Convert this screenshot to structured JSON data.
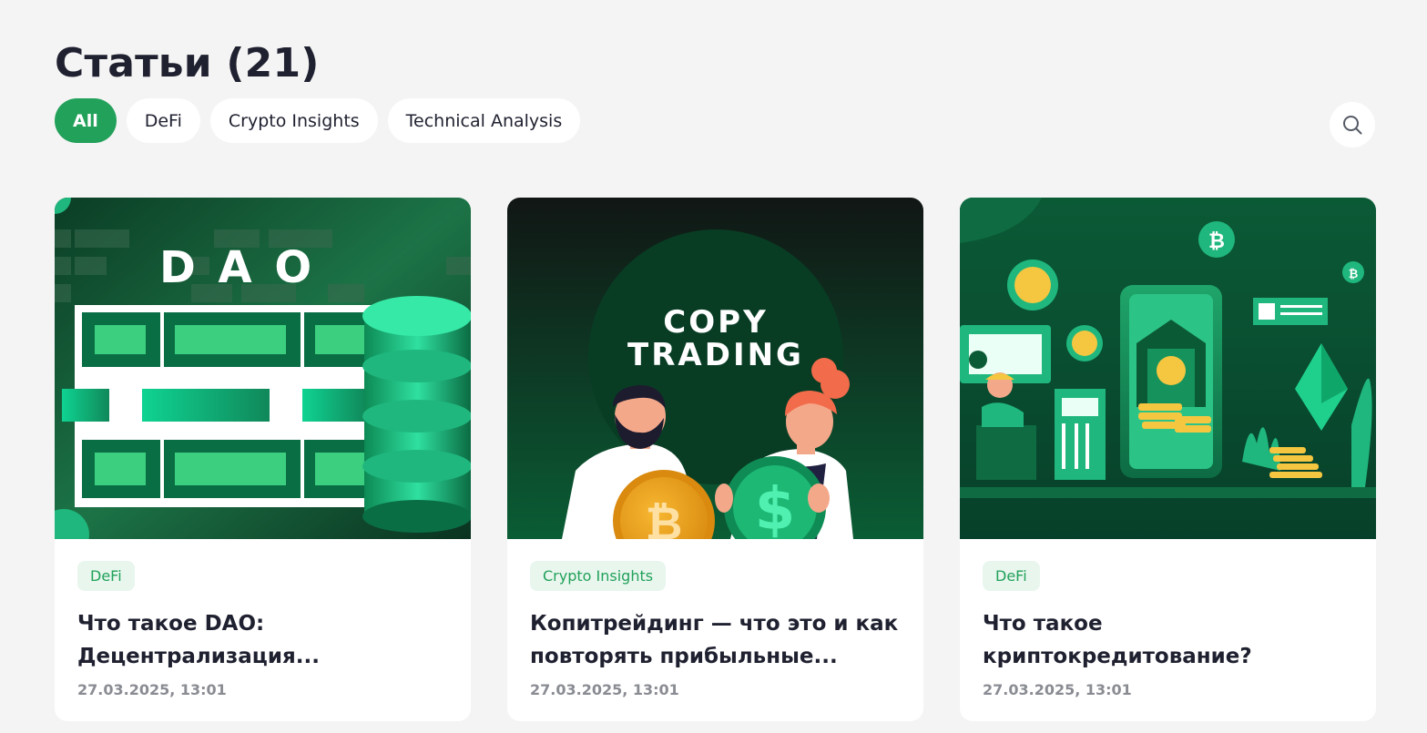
{
  "page": {
    "title": "Статьи (21)"
  },
  "filters": [
    {
      "label": "All",
      "active": true
    },
    {
      "label": "DeFi",
      "active": false
    },
    {
      "label": "Crypto Insights",
      "active": false
    },
    {
      "label": "Technical Analysis",
      "active": false
    }
  ],
  "search": {
    "icon": "search-icon"
  },
  "articles": [
    {
      "image_text": "D A O",
      "tag": "DeFi",
      "title": "Что такое DAO: Децентрализация...",
      "date": "27.03.2025, 13:01"
    },
    {
      "image_text_line1": "COPY",
      "image_text_line2": "TRADING",
      "tag": "Crypto Insights",
      "title": "Копитрейдинг — что это и как повторять прибыльные...",
      "date": "27.03.2025, 13:01"
    },
    {
      "tag": "DeFi",
      "title": "Что такое криптокредитование?",
      "date": "27.03.2025, 13:01"
    }
  ],
  "colors": {
    "accent": "#22a15a",
    "tag_bg": "#e8f6ee",
    "page_bg": "#f4f4f4"
  }
}
